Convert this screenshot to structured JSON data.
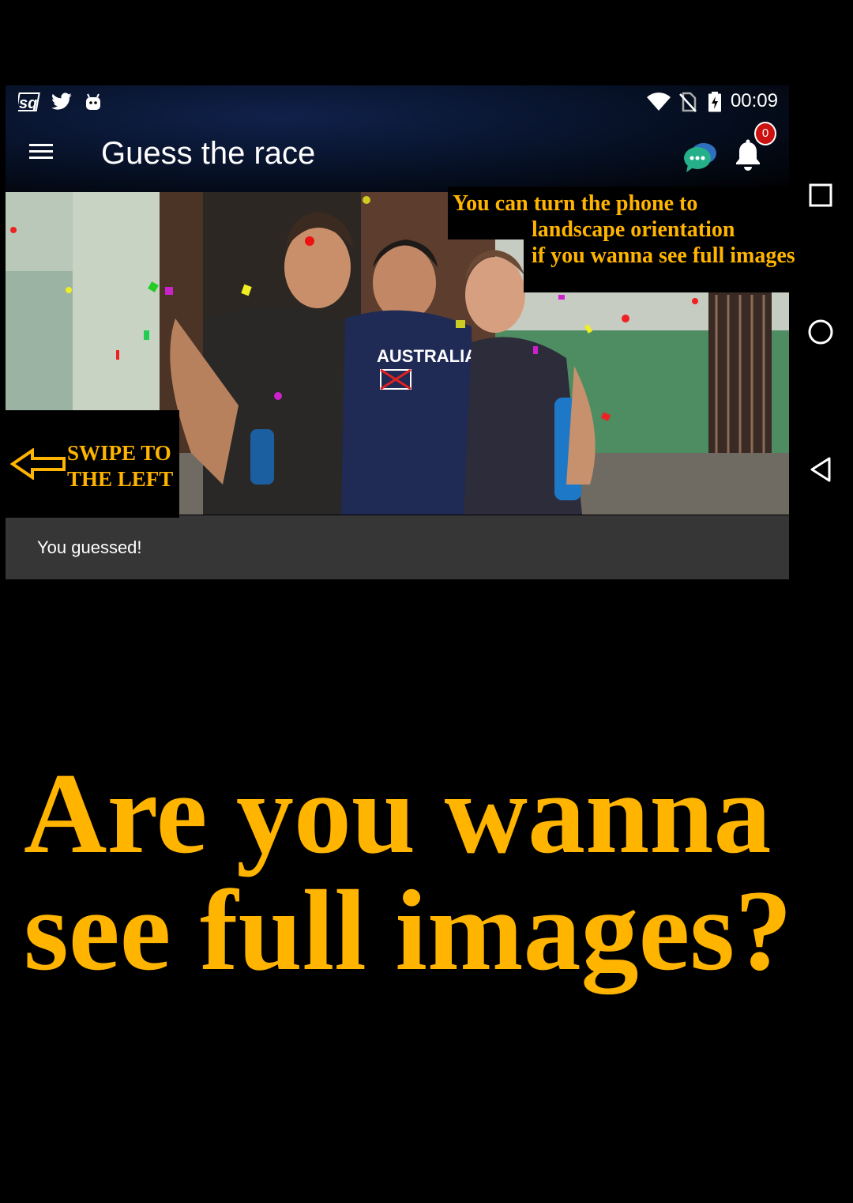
{
  "status_bar": {
    "time": "00:09",
    "left_icons": [
      "sq-app-icon",
      "twitter-icon",
      "android-icon"
    ],
    "right_icons": [
      "wifi-icon",
      "no-sim-icon",
      "battery-charging-icon"
    ]
  },
  "app_bar": {
    "title": "Guess the race",
    "notification_count": "0"
  },
  "photo": {
    "shirt_text": "AUSTRALIA"
  },
  "guess_bar": {
    "text": "You guessed!"
  },
  "orientation_hint": {
    "line1": "You can turn the phone to",
    "line2": "landscape orientation",
    "line3": "if you wanna see full images"
  },
  "swipe_hint": {
    "text": "SWIPE TO\nTHE LEFT"
  },
  "nav_bar": {
    "icons": [
      "recents-square-icon",
      "home-circle-icon",
      "back-triangle-icon"
    ]
  },
  "headline": {
    "text": "Are you wanna see full images?"
  },
  "colors": {
    "accent_yellow": "#ffb400",
    "badge_red": "#cc1111",
    "guess_bar_bg": "#363636"
  }
}
